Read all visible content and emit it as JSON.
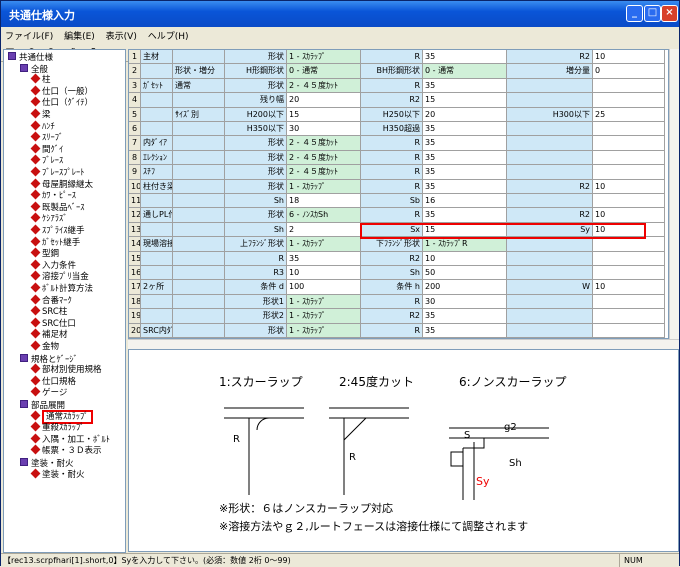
{
  "title": "共通仕様入力",
  "menu": [
    "ファイル(F)",
    "編集(E)",
    "表示(V)",
    "ヘルプ(H)"
  ],
  "toolbar": [
    "save-icon",
    "undo-icon",
    "redo-icon",
    "print-icon",
    "help-icon"
  ],
  "tree": [
    {
      "lv": 0,
      "t": "共通仕様",
      "i": "box"
    },
    {
      "lv": 1,
      "t": "全般",
      "i": "book"
    },
    {
      "lv": 2,
      "t": "柱",
      "i": "dia"
    },
    {
      "lv": 2,
      "t": "仕口（一般）",
      "i": "dia"
    },
    {
      "lv": 2,
      "t": "仕口（ｸﾞｲﾃ）",
      "i": "dia"
    },
    {
      "lv": 2,
      "t": "梁",
      "i": "dia"
    },
    {
      "lv": 2,
      "t": "ﾊﾝﾁ",
      "i": "dia"
    },
    {
      "lv": 2,
      "t": "ｽﾘｰﾌﾞ",
      "i": "dia"
    },
    {
      "lv": 2,
      "t": "間ｸﾞｲ",
      "i": "dia"
    },
    {
      "lv": 2,
      "t": "ﾌﾞﾚｰｽ",
      "i": "dia"
    },
    {
      "lv": 2,
      "t": "ﾌﾞﾚｰｽﾌﾟﾚｰﾄ",
      "i": "dia"
    },
    {
      "lv": 2,
      "t": "母屋胴縁継太",
      "i": "dia"
    },
    {
      "lv": 2,
      "t": "ｶﾜ・ﾋﾟｰｽ",
      "i": "dia"
    },
    {
      "lv": 2,
      "t": "既製品ﾍﾞｰｽ",
      "i": "dia"
    },
    {
      "lv": 2,
      "t": "ｹｼｱﾗｽﾞ",
      "i": "dia"
    },
    {
      "lv": 2,
      "t": "ｽﾌﾟﾗｲｽ継手",
      "i": "dia"
    },
    {
      "lv": 2,
      "t": "ｶﾞｾｯﾄ継手",
      "i": "dia"
    },
    {
      "lv": 2,
      "t": "型鋼",
      "i": "dia"
    },
    {
      "lv": 2,
      "t": "入力条件",
      "i": "dia"
    },
    {
      "lv": 2,
      "t": "溶接ﾌﾟﾘ当金",
      "i": "dia"
    },
    {
      "lv": 2,
      "t": "ﾎﾞﾙﾄ計算方法",
      "i": "dia"
    },
    {
      "lv": 2,
      "t": "合番ﾏｰｸ",
      "i": "dia"
    },
    {
      "lv": 2,
      "t": "SRC柱",
      "i": "dia"
    },
    {
      "lv": 2,
      "t": "SRC仕口",
      "i": "dia"
    },
    {
      "lv": 2,
      "t": "補足材",
      "i": "dia"
    },
    {
      "lv": 2,
      "t": "金物",
      "i": "dia"
    },
    {
      "lv": 1,
      "t": "規格とｹﾞｰｼﾞ",
      "i": "book"
    },
    {
      "lv": 2,
      "t": "部材別使用規格",
      "i": "dia"
    },
    {
      "lv": 2,
      "t": "仕口規格",
      "i": "dia"
    },
    {
      "lv": 2,
      "t": "ゲージ",
      "i": "dia"
    },
    {
      "lv": 1,
      "t": "部品展開",
      "i": "book"
    },
    {
      "lv": 2,
      "t": "通常ｽｶﾗｯﾌﾟ",
      "i": "dia",
      "sel": true
    },
    {
      "lv": 2,
      "t": "重殺ｽｶﾗｯﾌﾟ",
      "i": "dia"
    },
    {
      "lv": 2,
      "t": "入隅・加工・ﾎﾞﾙﾄ",
      "i": "dia"
    },
    {
      "lv": 2,
      "t": "帳票・３Ｄ表示",
      "i": "dia"
    },
    {
      "lv": 1,
      "t": "塗装・耐火",
      "i": "book"
    },
    {
      "lv": 2,
      "t": "塗装・耐火",
      "i": "dia"
    }
  ],
  "rows": [
    [
      "1",
      "主材",
      "",
      "形状",
      "1 - ｽｶﾗｯﾌﾟ",
      "R",
      "35",
      "R2",
      "10"
    ],
    [
      "2",
      "",
      "形状・増分",
      "H形鋼形状",
      "0 - 通常",
      "BH形鋼形状",
      "0 - 通常",
      "増分量",
      "0"
    ],
    [
      "3",
      "ｶﾞｾｯﾄ",
      "通常",
      "形状",
      "2 - ４５度ｶｯﾄ",
      "R",
      "35",
      "",
      ""
    ],
    [
      "4",
      "",
      "",
      "残り幅",
      "20",
      "R2",
      "15",
      "",
      ""
    ],
    [
      "5",
      "",
      "ｻｲｽﾞ別",
      "H200以下",
      "15",
      "H250以下",
      "20",
      "H300以下",
      "25"
    ],
    [
      "6",
      "",
      "",
      "H350以下",
      "30",
      "H350超過",
      "35",
      "",
      ""
    ],
    [
      "7",
      "内ﾀﾞｲｱ",
      "",
      "形状",
      "2 - ４５度ｶｯﾄ",
      "R",
      "35",
      "",
      ""
    ],
    [
      "8",
      "ｴﾚｸｼｮﾝ",
      "",
      "形状",
      "2 - ４５度ｶｯﾄ",
      "R",
      "35",
      "",
      ""
    ],
    [
      "9",
      "ｽﾁﾌ",
      "",
      "形状",
      "2 - ４５度ｶｯﾄ",
      "R",
      "35",
      "",
      ""
    ],
    [
      "10",
      "柱付き梁",
      "",
      "形状",
      "1 - ｽｶﾗｯﾌﾟ",
      "R",
      "35",
      "R2",
      "10"
    ],
    [
      "11",
      "",
      "",
      "Sh",
      "18",
      "Sb",
      "16",
      "",
      ""
    ],
    [
      "12",
      "通しPL付き梁",
      "",
      "形状",
      "6 - ﾉﾝｽｶSh",
      "R",
      "35",
      "R2",
      "10"
    ],
    [
      "13",
      "",
      "",
      "Sh",
      "2",
      "Sx",
      "15",
      "Sy",
      "10"
    ],
    [
      "14",
      "現場溶接",
      "",
      "上ﾌﾗﾝｼﾞ形状",
      "1 - ｽｶﾗｯﾌﾟ",
      "下ﾌﾗﾝｼﾞ形状",
      "1 - ｽｶﾗｯﾌﾟR",
      "",
      ""
    ],
    [
      "15",
      "",
      "",
      "R",
      "35",
      "R2",
      "10",
      "",
      ""
    ],
    [
      "16",
      "",
      "",
      "R3",
      "10",
      "Sh",
      "50",
      "",
      ""
    ],
    [
      "17",
      "2ヶ所",
      "",
      "条件 d",
      "100",
      "条件 h",
      "200",
      "W",
      "10"
    ],
    [
      "18",
      "",
      "",
      "形状1",
      "1 - ｽｶﾗｯﾌﾟ",
      "R",
      "30",
      "",
      ""
    ],
    [
      "19",
      "",
      "",
      "形状2",
      "1 - ｽｶﾗｯﾌﾟ",
      "R2",
      "35",
      "",
      ""
    ],
    [
      "20",
      "SRC内ﾀﾞｲｱ",
      "",
      "形状",
      "1 - ｽｶﾗｯﾌﾟ",
      "R",
      "35",
      "",
      ""
    ]
  ],
  "drawing": {
    "cap1": "1:スカーラップ",
    "cap2": "2:45度カット",
    "cap3": "6:ノンスカーラップ",
    "r": "R",
    "s": "S",
    "g2": "g2",
    "sh": "Sh",
    "sy": "Sy",
    "note1": "※形状：６はノンスカーラップ対応",
    "note2": "※溶接方法やｇ２,ルートフェースは溶接仕様にて調整されます"
  },
  "status": {
    "msg": "【rec13.scrpfhari[1].short,0】Syを入力して下さい。(必須：数値 2桁 0～99)",
    "num": "NUM"
  }
}
